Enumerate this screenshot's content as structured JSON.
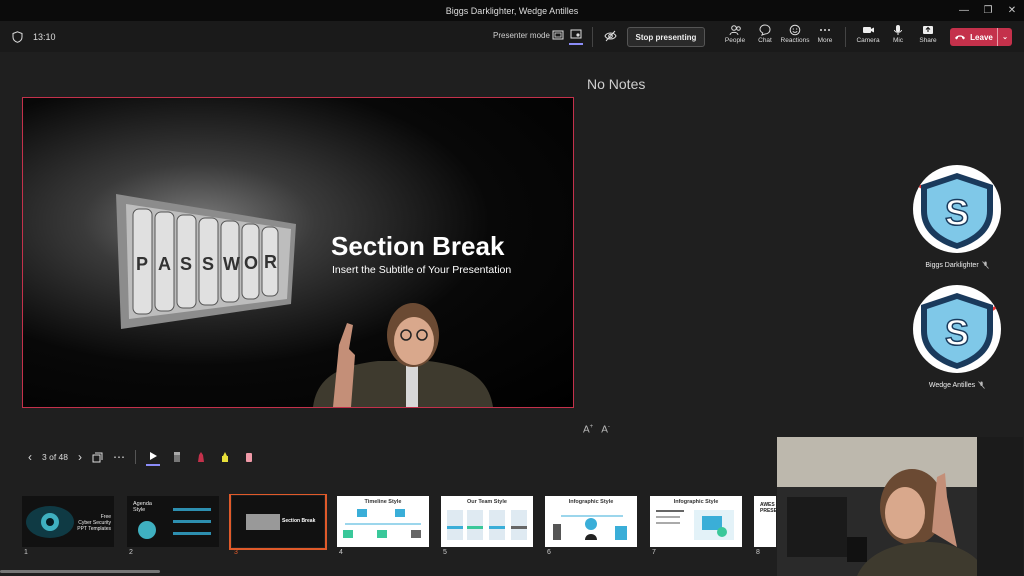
{
  "window": {
    "title": "Biggs Darklighter, Wedge Antilles"
  },
  "toolbar": {
    "time": "13:10",
    "presenter_mode_label": "Presenter mode",
    "stop_presenting": "Stop presenting",
    "people": "People",
    "chat": "Chat",
    "reactions": "Reactions",
    "more": "More",
    "camera": "Camera",
    "mic": "Mic",
    "share": "Share",
    "leave": "Leave"
  },
  "slide": {
    "title": "Section Break",
    "subtitle": "Insert the Subtitle of Your Presentation"
  },
  "notes": {
    "text": "No Notes"
  },
  "navigation": {
    "position": "3 of 48"
  },
  "participants": [
    {
      "name": "Biggs Darklighter"
    },
    {
      "name": "Wedge Antilles"
    }
  ],
  "thumbnails": [
    {
      "num": "1",
      "text1": "Free",
      "text2": "Cyber Security",
      "text3": "PPT Templates"
    },
    {
      "num": "2",
      "title": "Agenda Style"
    },
    {
      "num": "3",
      "title": "Section Break"
    },
    {
      "num": "4",
      "title": "Timeline Style"
    },
    {
      "num": "5",
      "title": "Our Team Style"
    },
    {
      "num": "6",
      "title": "Infographic Style"
    },
    {
      "num": "7",
      "title": "Infographic Style"
    },
    {
      "num": "8",
      "title": "AWES PRESE"
    }
  ],
  "colors": {
    "accent": "#8b8cf7",
    "leave": "#c4314b",
    "selected": "#e05a2a"
  }
}
